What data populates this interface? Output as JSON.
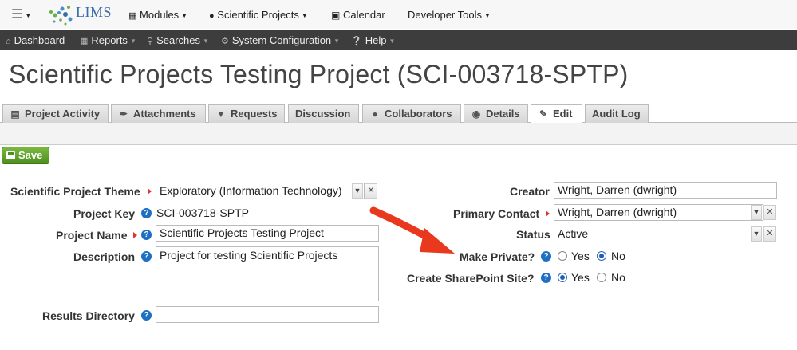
{
  "topnav": {
    "logo_text": "LIMS",
    "modules": "Modules",
    "scientific_projects": "Scientific Projects",
    "calendar": "Calendar",
    "developer_tools": "Developer Tools"
  },
  "subnav": {
    "dashboard": "Dashboard",
    "reports": "Reports",
    "searches": "Searches",
    "system_configuration": "System Configuration",
    "help": "Help"
  },
  "page_title": "Scientific Projects Testing Project (SCI-003718-SPTP)",
  "tabs": [
    {
      "label": "Project Activity",
      "icon": "list-icon"
    },
    {
      "label": "Attachments",
      "icon": "paperclip-icon"
    },
    {
      "label": "Requests",
      "icon": "cart-icon"
    },
    {
      "label": "Discussion",
      "icon": ""
    },
    {
      "label": "Collaborators",
      "icon": "users-icon"
    },
    {
      "label": "Details",
      "icon": "eye-icon"
    },
    {
      "label": "Edit",
      "icon": "edit-icon",
      "active": true
    },
    {
      "label": "Audit Log",
      "icon": ""
    }
  ],
  "toolbar": {
    "save_label": "Save"
  },
  "form": {
    "theme_label": "Scientific Project Theme",
    "theme_value": "Exploratory (Information Technology)",
    "key_label": "Project Key",
    "key_value": "SCI-003718-SPTP",
    "name_label": "Project Name",
    "name_value": "Scientific Projects Testing Project",
    "description_label": "Description",
    "description_value": "Project for testing Scientific Projects",
    "results_label": "Results Directory",
    "results_value": "",
    "creator_label": "Creator",
    "creator_value": "Wright, Darren (dwright)",
    "contact_label": "Primary Contact",
    "contact_value": "Wright, Darren (dwright)",
    "status_label": "Status",
    "status_value": "Active",
    "private_label": "Make Private?",
    "private_value": "No",
    "sharepoint_label": "Create SharePoint Site?",
    "sharepoint_value": "Yes",
    "yes": "Yes",
    "no": "No"
  },
  "colors": {
    "subnav_bg": "#3d3d3d",
    "save_green": "#5a9e28",
    "help_blue": "#1d6fc4",
    "arrow_red": "#e8391f",
    "required_red": "#dd3333"
  }
}
